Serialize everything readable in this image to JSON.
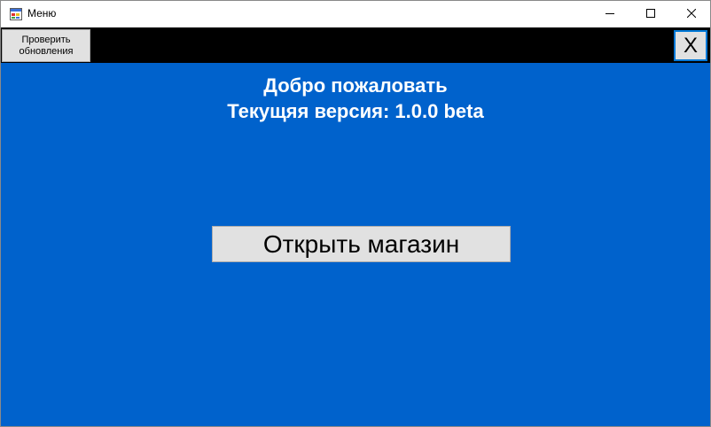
{
  "window": {
    "title": "Меню",
    "icon": "app-form-icon"
  },
  "title_controls": {
    "minimize_icon": "minimize-icon",
    "maximize_icon": "maximize-icon",
    "close_icon": "close-icon"
  },
  "toolbar": {
    "check_updates_label": "Проверить обновления",
    "exit_label": "X"
  },
  "main": {
    "welcome_text": "Добро пожаловать",
    "version_label": "Текущяя версия:",
    "version_value": "1.0.0 beta",
    "open_shop_label": "Открыть магазин"
  },
  "colors": {
    "panel_blue": "#0062cc",
    "toolbar_black": "#000000",
    "button_gray": "#e1e1e1",
    "focus_border": "#0078d7"
  }
}
